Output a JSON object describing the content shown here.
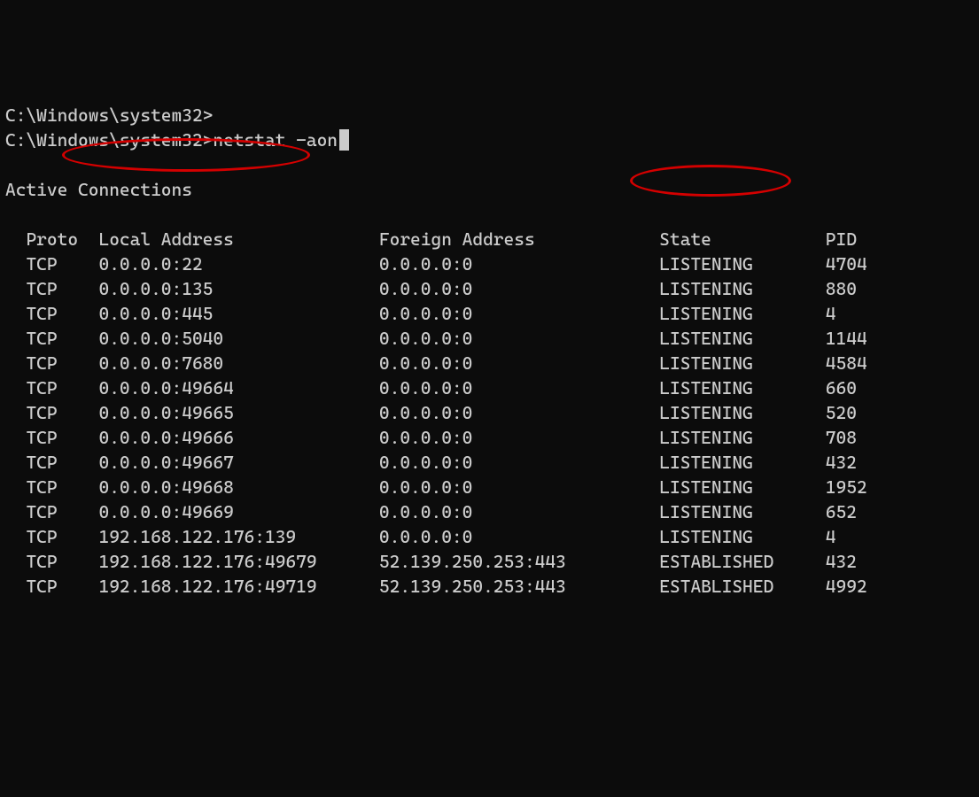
{
  "prompt1": "C:\\Windows\\system32>",
  "prompt2": "C:\\Windows\\system32>",
  "command": "netstat -aon",
  "section_title": "Active Connections",
  "headers": {
    "proto": "Proto",
    "local": "Local Address",
    "foreign": "Foreign Address",
    "state": "State",
    "pid": "PID"
  },
  "col_indent": "  ",
  "col_widths": {
    "proto": 7,
    "local": 27,
    "foreign": 27,
    "state": 16
  },
  "rows": [
    {
      "proto": "TCP",
      "local": "0.0.0.0:22",
      "foreign": "0.0.0.0:0",
      "state": "LISTENING",
      "pid": "4704"
    },
    {
      "proto": "TCP",
      "local": "0.0.0.0:135",
      "foreign": "0.0.0.0:0",
      "state": "LISTENING",
      "pid": "880"
    },
    {
      "proto": "TCP",
      "local": "0.0.0.0:445",
      "foreign": "0.0.0.0:0",
      "state": "LISTENING",
      "pid": "4"
    },
    {
      "proto": "TCP",
      "local": "0.0.0.0:5040",
      "foreign": "0.0.0.0:0",
      "state": "LISTENING",
      "pid": "1144"
    },
    {
      "proto": "TCP",
      "local": "0.0.0.0:7680",
      "foreign": "0.0.0.0:0",
      "state": "LISTENING",
      "pid": "4584"
    },
    {
      "proto": "TCP",
      "local": "0.0.0.0:49664",
      "foreign": "0.0.0.0:0",
      "state": "LISTENING",
      "pid": "660"
    },
    {
      "proto": "TCP",
      "local": "0.0.0.0:49665",
      "foreign": "0.0.0.0:0",
      "state": "LISTENING",
      "pid": "520"
    },
    {
      "proto": "TCP",
      "local": "0.0.0.0:49666",
      "foreign": "0.0.0.0:0",
      "state": "LISTENING",
      "pid": "708"
    },
    {
      "proto": "TCP",
      "local": "0.0.0.0:49667",
      "foreign": "0.0.0.0:0",
      "state": "LISTENING",
      "pid": "432"
    },
    {
      "proto": "TCP",
      "local": "0.0.0.0:49668",
      "foreign": "0.0.0.0:0",
      "state": "LISTENING",
      "pid": "1952"
    },
    {
      "proto": "TCP",
      "local": "0.0.0.0:49669",
      "foreign": "0.0.0.0:0",
      "state": "LISTENING",
      "pid": "652"
    },
    {
      "proto": "TCP",
      "local": "192.168.122.176:139",
      "foreign": "0.0.0.0:0",
      "state": "LISTENING",
      "pid": "4"
    },
    {
      "proto": "TCP",
      "local": "192.168.122.176:49679",
      "foreign": "52.139.250.253:443",
      "state": "ESTABLISHED",
      "pid": "432"
    },
    {
      "proto": "TCP",
      "local": "192.168.122.176:49719",
      "foreign": "52.139.250.253:443",
      "state": "ESTABLISHED",
      "pid": "4992"
    }
  ]
}
